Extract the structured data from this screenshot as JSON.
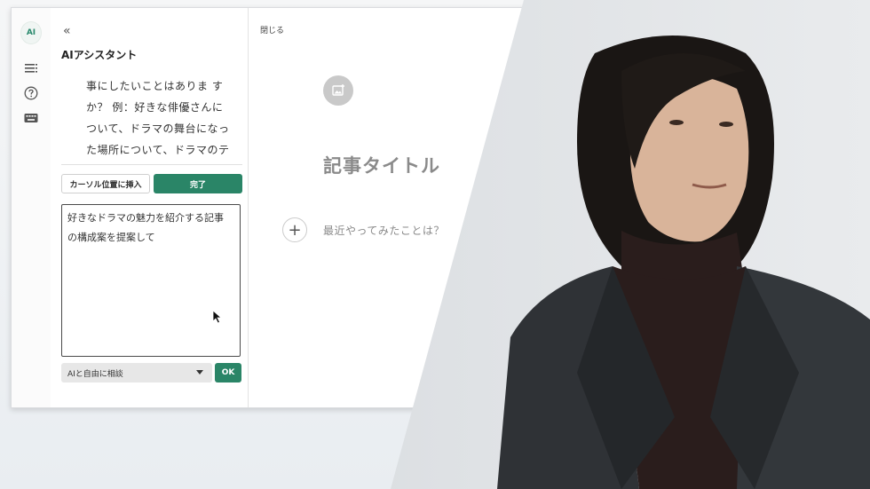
{
  "rail": {
    "logo_text": "AI",
    "icons": [
      "ai-logo-icon",
      "list-icon",
      "help-icon",
      "keyboard-icon"
    ]
  },
  "panel": {
    "collapse_glyph": "«",
    "title": "AIアシスタント",
    "chat_lines": [
      "事にしたいことはありま す",
      "か？ 例：好きな俳優さんに",
      "ついて、ドラマの舞台になっ",
      "た場所について、ドラマのテ"
    ],
    "insert_label": "カーソル位置に挿入",
    "done_label": "完了",
    "prompt_lines": [
      "好きなドラマの魅力を紹介する記事",
      "の構成案を提案して"
    ],
    "mode_label": "AIと自由に相談",
    "ok_label": "OK"
  },
  "editor": {
    "close_label": "閉じる",
    "title_placeholder": "記事タイトル",
    "body_placeholder": "最近やってみたことは？",
    "add_glyph": "+"
  },
  "colors": {
    "accent": "#2a8567",
    "placeholder": "#8a8a8a"
  }
}
